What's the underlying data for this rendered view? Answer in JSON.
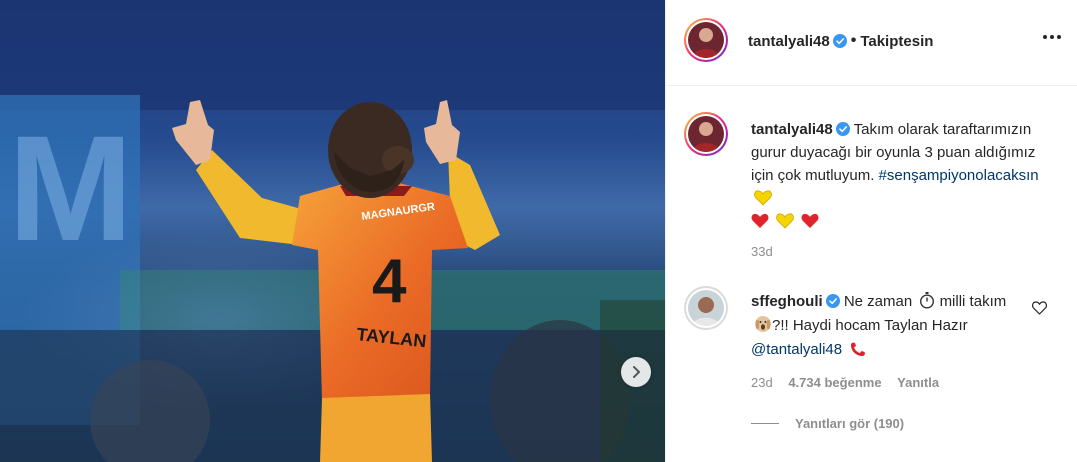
{
  "post": {
    "author": "tantalyali48",
    "follow_status": "Takiptesin",
    "more_icon": "more-horizontal-icon"
  },
  "photo": {
    "jersey_number": "4",
    "jersey_name": "TAYLAN",
    "sponsor": "MAGNAURGR"
  },
  "caption": {
    "username": "tantalyali48",
    "text": "Takım olarak taraftarımızın gurur duyacağı bir oyunla 3 puan aldığımız için çok mutluyum.",
    "hashtag": "#senşampiyonolacaksın",
    "time": "33d"
  },
  "comment": {
    "username": "sffeghouli",
    "text_a": "Ne zaman",
    "text_b": "milli takım",
    "text_c": "?!! Haydi hocam Taylan Hazır",
    "mention": "@tantalyali48",
    "time": "23d",
    "likes": "4.734 beğenme",
    "reply": "Yanıtla",
    "view_replies": "Yanıtları gör (190)"
  },
  "colors": {
    "link": "#00376b",
    "muted": "#8e8e8e",
    "verified": "#3897f0",
    "jersey_orange": "#f0762b",
    "jersey_yellow": "#f2c230"
  }
}
